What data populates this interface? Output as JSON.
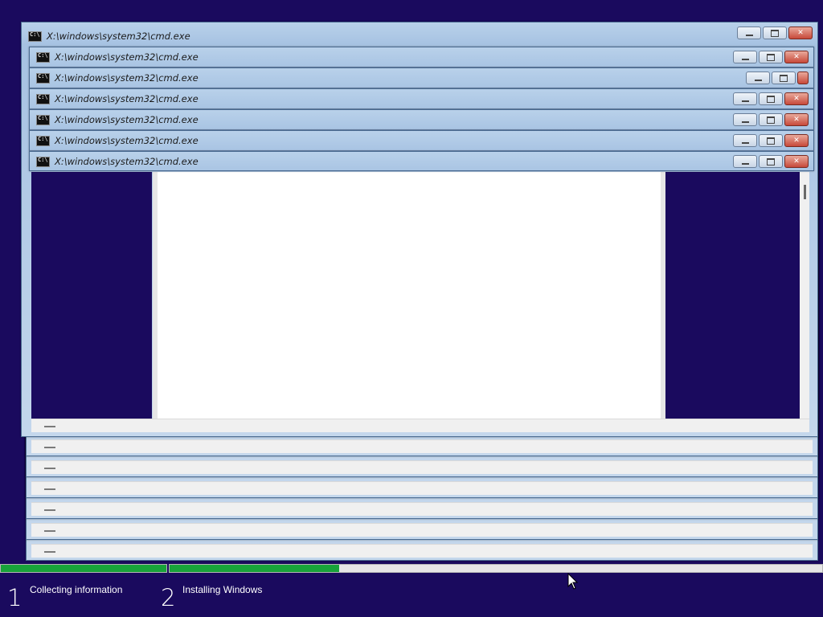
{
  "windows": [
    {
      "title": "X:\\windows\\system32\\cmd.exe"
    },
    {
      "title": "X:\\windows\\system32\\cmd.exe"
    },
    {
      "title": "X:\\windows\\system32\\cmd.exe"
    },
    {
      "title": "X:\\windows\\system32\\cmd.exe"
    },
    {
      "title": "X:\\windows\\system32\\cmd.exe"
    },
    {
      "title": "X:\\windows\\system32\\cmd.exe"
    },
    {
      "title": "X:\\windows\\system32\\cmd.exe"
    }
  ],
  "icons": {
    "app": "cmd-icon",
    "minimize": "minimize-icon",
    "maximize": "maximize-icon",
    "close": "close-icon",
    "cursor": "mouse-cursor-icon"
  },
  "app_icon_text": "C:\\",
  "setup": {
    "steps": [
      {
        "number": "1",
        "label": "Collecting information",
        "progress": 1.0
      },
      {
        "number": "2",
        "label": "Installing Windows",
        "progress": 0.26
      }
    ]
  },
  "colors": {
    "background": "#1a0a5e",
    "progress": "#18a33a"
  }
}
